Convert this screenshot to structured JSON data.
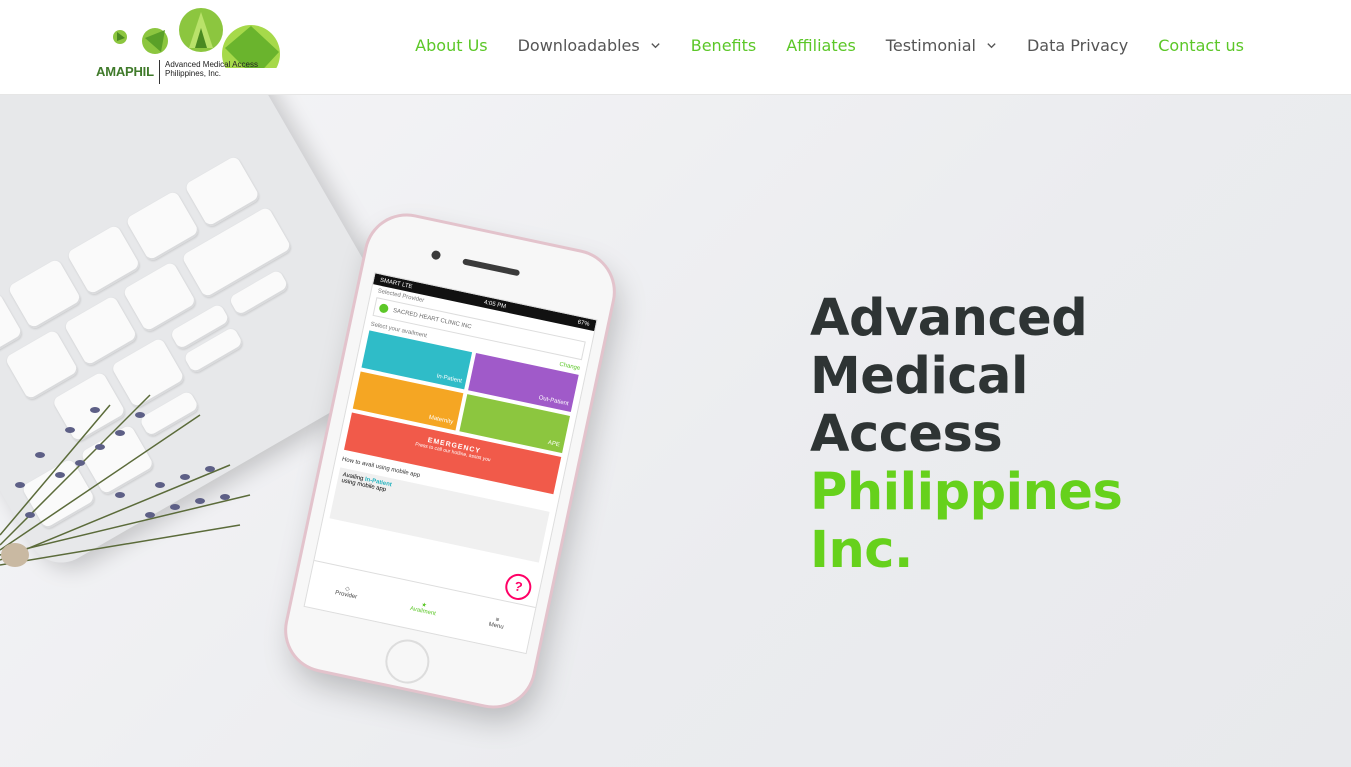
{
  "header": {
    "logo": {
      "brand": "AMAPHIL",
      "line1": "Advanced Medical Access",
      "line2": "Philippines, Inc."
    },
    "nav": [
      {
        "label": "About Us",
        "color": "#5cc728"
      },
      {
        "label": "Downloadables",
        "color": "#555555",
        "dropdown": true
      },
      {
        "label": "Benefits",
        "color": "#5cc728"
      },
      {
        "label": "Affiliates",
        "color": "#5cc728"
      },
      {
        "label": "Testimonial",
        "color": "#555555",
        "dropdown": true
      },
      {
        "label": "Data Privacy",
        "color": "#555555"
      },
      {
        "label": "Contact us",
        "color": "#5cc728"
      }
    ]
  },
  "hero": {
    "title_lines_dark": [
      "Advanced",
      "Medical",
      "Access"
    ],
    "title_lines_green": [
      "Philippines",
      "Inc."
    ],
    "dark_color": "#2e3434",
    "accent_color": "#66d11c"
  },
  "phone_screen": {
    "carrier": "SMART LTE",
    "time": "4:05 PM",
    "battery": "67%",
    "selected_provider_label": "Selected Provider",
    "provider_name": "SACRED HEART CLINIC INC",
    "select_label": "Select your availment",
    "change_label": "Change",
    "tiles": [
      {
        "label": "In-Patient",
        "color": "#2fbcc8"
      },
      {
        "label": "Out-Patient",
        "color": "#a05ac9"
      },
      {
        "label": "Maternity",
        "color": "#f5a623"
      },
      {
        "label": "APE",
        "color": "#8cc63f"
      }
    ],
    "emergency_label": "EMERGENCY",
    "emergency_sub": "Press to call our hotline, assist you",
    "howto_label": "How to avail using mobile app",
    "avail_line1_prefix": "Availing",
    "avail_line1_accent": "In-Patient",
    "avail_line2": "using mobile app",
    "tabs": [
      "Provider",
      "Availment",
      "Menu"
    ]
  }
}
